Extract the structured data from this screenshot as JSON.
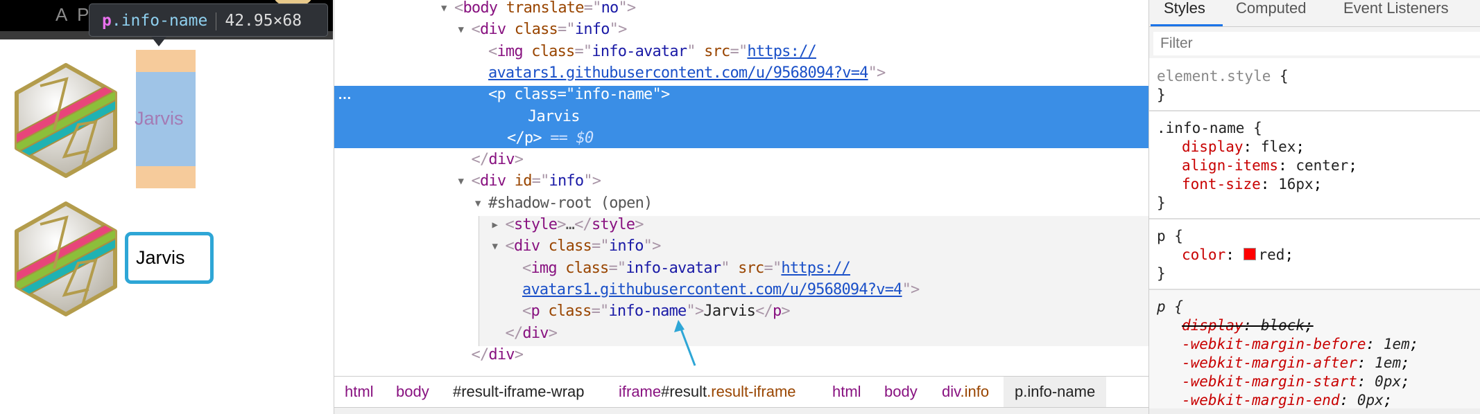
{
  "page": {
    "header_text": "A PEN BY",
    "tooltip": {
      "tag": "p",
      "class": ".info-name",
      "size": "42.95×68"
    },
    "avatar_name_1": "Jarvis",
    "avatar_name_2": "Jarvis",
    "colors": {
      "highlight_margin": "#f6cb9b",
      "highlight_content": "#9fc4e7",
      "box_border": "#2ea6d6"
    }
  },
  "elements": {
    "selected_dots": "…",
    "lines": [
      {
        "depth": 0,
        "arrow": "down",
        "tokens": [
          [
            "p",
            "<"
          ],
          [
            "tag",
            "body"
          ],
          [
            "p",
            " "
          ],
          [
            "attr",
            "translate"
          ],
          [
            "p",
            "=\""
          ],
          [
            "val",
            "no"
          ],
          [
            "p",
            "\">"
          ]
        ]
      },
      {
        "depth": 1,
        "arrow": "down",
        "tokens": [
          [
            "p",
            "<"
          ],
          [
            "tag",
            "div"
          ],
          [
            "p",
            " "
          ],
          [
            "attr",
            "class"
          ],
          [
            "p",
            "=\""
          ],
          [
            "val",
            "info"
          ],
          [
            "p",
            "\">"
          ]
        ]
      },
      {
        "depth": 2,
        "tokens": [
          [
            "p",
            "<"
          ],
          [
            "tag",
            "img"
          ],
          [
            "p",
            " "
          ],
          [
            "attr",
            "class"
          ],
          [
            "p",
            "=\""
          ],
          [
            "val",
            "info-avatar"
          ],
          [
            "p",
            "\" "
          ],
          [
            "attr",
            "src"
          ],
          [
            "p",
            "=\""
          ],
          [
            "link",
            "https://"
          ]
        ]
      },
      {
        "depth": 2,
        "tokens": [
          [
            "link",
            "avatars1.githubusercontent.com/u/9568094?v=4"
          ],
          [
            "p",
            "\">"
          ]
        ]
      },
      {
        "depth": 2,
        "selected": true,
        "tokens": [
          [
            "p",
            "<"
          ],
          [
            "tag",
            "p"
          ],
          [
            "p",
            " "
          ],
          [
            "attr",
            "class"
          ],
          [
            "p",
            "=\""
          ],
          [
            "val",
            "info-name"
          ],
          [
            "p",
            "\">"
          ]
        ]
      },
      {
        "depth": 2,
        "kind": "text",
        "selected": true,
        "tokens": [
          [
            "text",
            "Jarvis"
          ]
        ]
      },
      {
        "depth": 2,
        "kind": "close",
        "selected": true,
        "tokens": [
          [
            "p",
            "</"
          ],
          [
            "tag",
            "p"
          ],
          [
            "p",
            ">"
          ],
          [
            "eq",
            " == "
          ],
          [
            "ref",
            "$0"
          ]
        ]
      },
      {
        "depth": 1,
        "tokens": [
          [
            "p",
            "</"
          ],
          [
            "tag",
            "div"
          ],
          [
            "p",
            ">"
          ]
        ]
      },
      {
        "depth": 1,
        "arrow": "down",
        "tokens": [
          [
            "p",
            "<"
          ],
          [
            "tag",
            "div"
          ],
          [
            "p",
            " "
          ],
          [
            "attr",
            "id"
          ],
          [
            "p",
            "=\""
          ],
          [
            "val",
            "info"
          ],
          [
            "p",
            "\">"
          ]
        ]
      },
      {
        "depth": 2,
        "arrow": "down",
        "tokens": [
          [
            "dim",
            "#shadow-root (open)"
          ]
        ]
      },
      {
        "depth": 3,
        "arrow": "right",
        "tokens": [
          [
            "p",
            "<"
          ],
          [
            "tag",
            "style"
          ],
          [
            "p",
            ">"
          ],
          [
            "dim",
            "…"
          ],
          [
            "p",
            "</"
          ],
          [
            "tag",
            "style"
          ],
          [
            "p",
            ">"
          ]
        ]
      },
      {
        "depth": 3,
        "arrow": "down",
        "tokens": [
          [
            "p",
            "<"
          ],
          [
            "tag",
            "div"
          ],
          [
            "p",
            " "
          ],
          [
            "attr",
            "class"
          ],
          [
            "p",
            "=\""
          ],
          [
            "val",
            "info"
          ],
          [
            "p",
            "\">"
          ]
        ]
      },
      {
        "depth": 4,
        "tokens": [
          [
            "p",
            "<"
          ],
          [
            "tag",
            "img"
          ],
          [
            "p",
            " "
          ],
          [
            "attr",
            "class"
          ],
          [
            "p",
            "=\""
          ],
          [
            "val",
            "info-avatar"
          ],
          [
            "p",
            "\" "
          ],
          [
            "attr",
            "src"
          ],
          [
            "p",
            "=\""
          ],
          [
            "link",
            "https://"
          ]
        ]
      },
      {
        "depth": 4,
        "tokens": [
          [
            "link",
            "avatars1.githubusercontent.com/u/9568094?v=4"
          ],
          [
            "p",
            "\">"
          ]
        ]
      },
      {
        "depth": 4,
        "tokens": [
          [
            "p",
            "<"
          ],
          [
            "tag",
            "p"
          ],
          [
            "p",
            " "
          ],
          [
            "attr",
            "class"
          ],
          [
            "p",
            "=\""
          ],
          [
            "val",
            "info-name"
          ],
          [
            "p",
            "\">"
          ],
          [
            "text",
            "Jarvis"
          ],
          [
            "p",
            "</"
          ],
          [
            "tag",
            "p"
          ],
          [
            "p",
            ">"
          ]
        ]
      },
      {
        "depth": 3,
        "tokens": [
          [
            "p",
            "</"
          ],
          [
            "tag",
            "div"
          ],
          [
            "p",
            ">"
          ]
        ]
      },
      {
        "depth": 1,
        "tokens": [
          [
            "p",
            "</"
          ],
          [
            "tag",
            "div"
          ],
          [
            "p",
            ">"
          ]
        ]
      }
    ],
    "breadcrumbs": [
      [
        [
          "c-tag",
          "html"
        ]
      ],
      [
        [
          "c-tag",
          "body"
        ]
      ],
      [
        [
          "c-id",
          "#result-iframe-wrap"
        ]
      ],
      [
        [
          "c-tag",
          "iframe"
        ],
        [
          "c-id",
          "#result"
        ],
        [
          "c-cls",
          ".result-iframe"
        ]
      ],
      [
        [
          "c-tag",
          "html"
        ]
      ],
      [
        [
          "c-tag",
          "body"
        ]
      ],
      [
        [
          "c-tag",
          "div"
        ],
        [
          "c-cls",
          ".info"
        ]
      ],
      [
        [
          "c-id",
          "p.info-name"
        ]
      ]
    ],
    "selection_color": "#3a8ee6"
  },
  "styles": {
    "tabs": [
      "Styles",
      "Computed",
      "Event Listeners"
    ],
    "active_tab": "Styles",
    "filter_placeholder": "Filter",
    "rules": [
      {
        "selector": "element.style",
        "muted": true,
        "props": []
      },
      {
        "selector": ".info-name",
        "props": [
          {
            "name": "display",
            "value": "flex"
          },
          {
            "name": "align-items",
            "value": "center"
          },
          {
            "name": "font-size",
            "value": "16px"
          }
        ]
      },
      {
        "selector": "p",
        "props": [
          {
            "name": "color",
            "value": "red",
            "swatch": "#ff0000"
          }
        ]
      },
      {
        "selector": "p",
        "user_agent": true,
        "props": [
          {
            "name": "display",
            "value": "block",
            "overridden": true
          },
          {
            "name": "-webkit-margin-before",
            "value": "1em"
          },
          {
            "name": "-webkit-margin-after",
            "value": "1em"
          },
          {
            "name": "-webkit-margin-start",
            "value": "0px"
          },
          {
            "name": "-webkit-margin-end",
            "value": "0px"
          }
        ]
      }
    ]
  }
}
